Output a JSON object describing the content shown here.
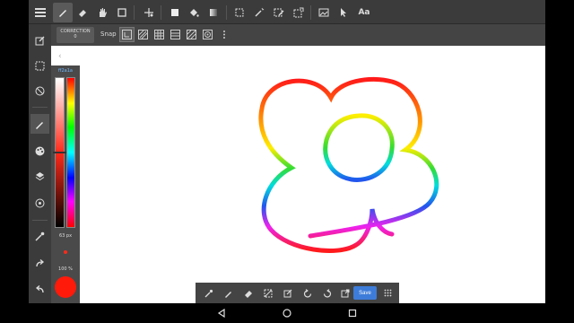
{
  "toolbar": {
    "tools": [
      {
        "name": "pen-tool",
        "icon": "pen-icon",
        "active": true
      },
      {
        "name": "eraser-tool",
        "icon": "eraser-icon"
      },
      {
        "name": "hand-tool",
        "icon": "hand-icon"
      },
      {
        "name": "shape-tool",
        "icon": "square-icon"
      },
      {
        "name": "move-tool",
        "icon": "move-icon"
      },
      {
        "name": "fill-color-tool",
        "icon": "filled-square-icon"
      },
      {
        "name": "bucket-tool",
        "icon": "paint-bucket-icon"
      },
      {
        "name": "gradient-tool",
        "icon": "gradient-icon"
      },
      {
        "name": "select-tool",
        "icon": "dashed-select-icon"
      },
      {
        "name": "magic-wand-tool",
        "icon": "magic-wand-icon"
      },
      {
        "name": "select-pen-tool",
        "icon": "select-pen-icon"
      },
      {
        "name": "select-edit-tool",
        "icon": "select-edit-icon"
      },
      {
        "name": "import-tool",
        "icon": "image-icon"
      },
      {
        "name": "pointer-tool",
        "icon": "pointer-icon"
      },
      {
        "name": "text-tool",
        "icon": "text-icon"
      }
    ],
    "text_tool_label": "Aa"
  },
  "subbar": {
    "correction_label": "CORRECTION",
    "correction_value": "0",
    "snap_label": "Snap"
  },
  "color_panel": {
    "hex": "ff2a1a",
    "brush_size": "63 px",
    "opacity": "100 %",
    "color": "#ff1a0a"
  },
  "bottom_toolbar": {
    "save_label": "Save"
  },
  "colors": {
    "accent": "#3d7cd9",
    "panel": "#3b3b3b",
    "canvas": "#ffffff"
  }
}
